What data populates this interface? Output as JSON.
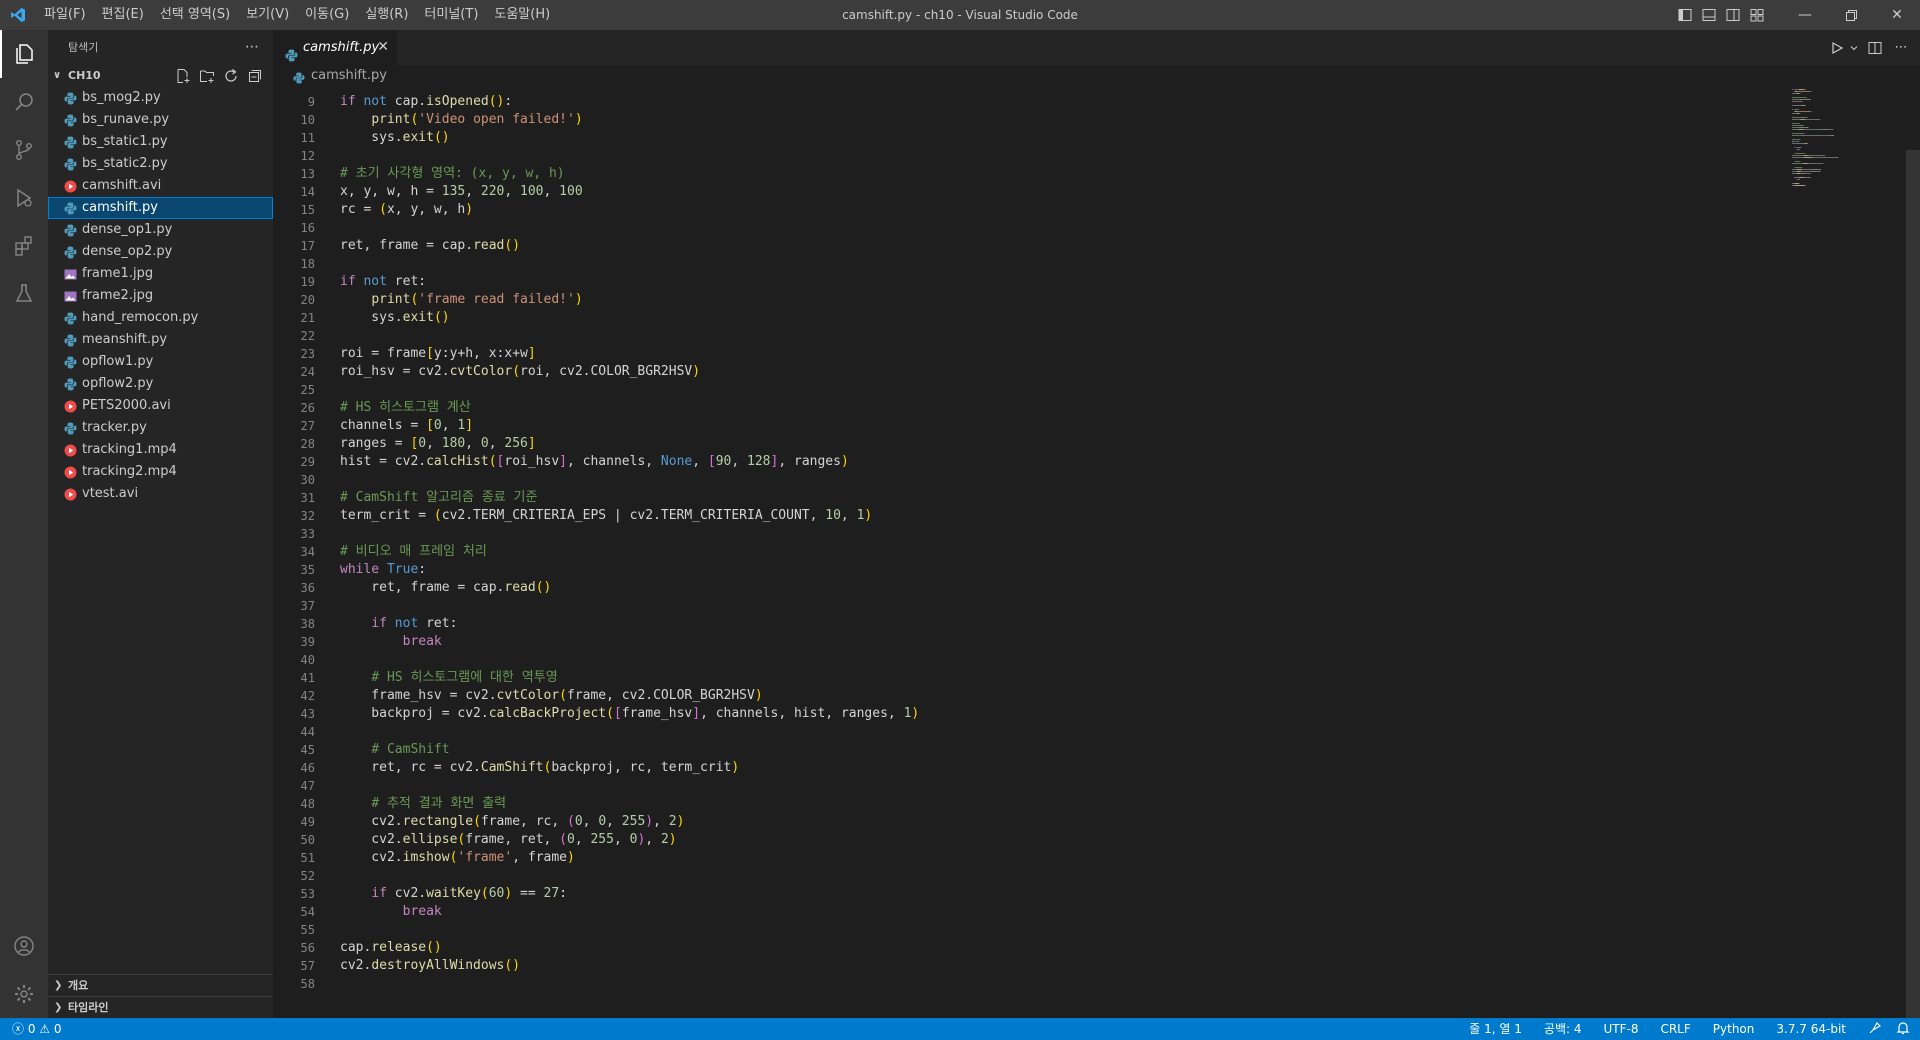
{
  "window": {
    "title": "camshift.py - ch10 - Visual Studio Code",
    "menu": [
      "파일(F)",
      "편집(E)",
      "선택 영역(S)",
      "보기(V)",
      "이동(G)",
      "실행(R)",
      "터미널(T)",
      "도움말(H)"
    ]
  },
  "sidebar": {
    "header": "탐색기",
    "folder": "CH10",
    "files": [
      {
        "name": "bs_mog2.py",
        "type": "python"
      },
      {
        "name": "bs_runave.py",
        "type": "python"
      },
      {
        "name": "bs_static1.py",
        "type": "python"
      },
      {
        "name": "bs_static2.py",
        "type": "python"
      },
      {
        "name": "camshift.avi",
        "type": "video"
      },
      {
        "name": "camshift.py",
        "type": "python"
      },
      {
        "name": "dense_op1.py",
        "type": "python"
      },
      {
        "name": "dense_op2.py",
        "type": "python"
      },
      {
        "name": "frame1.jpg",
        "type": "image"
      },
      {
        "name": "frame2.jpg",
        "type": "image"
      },
      {
        "name": "hand_remocon.py",
        "type": "python"
      },
      {
        "name": "meanshift.py",
        "type": "python"
      },
      {
        "name": "opflow1.py",
        "type": "python"
      },
      {
        "name": "opflow2.py",
        "type": "python"
      },
      {
        "name": "PETS2000.avi",
        "type": "video"
      },
      {
        "name": "tracker.py",
        "type": "python"
      },
      {
        "name": "tracking1.mp4",
        "type": "video"
      },
      {
        "name": "tracking2.mp4",
        "type": "video"
      },
      {
        "name": "vtest.avi",
        "type": "video"
      }
    ],
    "selected_file": "camshift.py",
    "sections": [
      "개요",
      "타임라인"
    ]
  },
  "editor": {
    "tab_label": "camshift.py",
    "breadcrumb": "camshift.py",
    "lines": [
      {
        "n": 9,
        "tokens": [
          {
            "t": "if",
            "c": "kf"
          },
          {
            "t": " "
          },
          {
            "t": "not",
            "c": "kw"
          },
          {
            "t": " cap."
          },
          {
            "t": "isOpened",
            "c": "fn"
          },
          {
            "t": "()",
            "c": "b1"
          },
          {
            "t": ":"
          }
        ]
      },
      {
        "n": 10,
        "tokens": [
          {
            "t": "    "
          },
          {
            "t": "print",
            "c": "fn"
          },
          {
            "t": "(",
            "c": "b1"
          },
          {
            "t": "'Video open failed!'",
            "c": "st"
          },
          {
            "t": ")",
            "c": "b1"
          }
        ]
      },
      {
        "n": 11,
        "tokens": [
          {
            "t": "    sys."
          },
          {
            "t": "exit",
            "c": "fn"
          },
          {
            "t": "()",
            "c": "b1"
          }
        ]
      },
      {
        "n": 12,
        "tokens": []
      },
      {
        "n": 13,
        "tokens": [
          {
            "t": "# 초기 사각형 영역: (x, y, w, h)",
            "c": "cm"
          }
        ]
      },
      {
        "n": 14,
        "tokens": [
          {
            "t": "x, y, w, h = "
          },
          {
            "t": "135",
            "c": "nu"
          },
          {
            "t": ", "
          },
          {
            "t": "220",
            "c": "nu"
          },
          {
            "t": ", "
          },
          {
            "t": "100",
            "c": "nu"
          },
          {
            "t": ", "
          },
          {
            "t": "100",
            "c": "nu"
          }
        ]
      },
      {
        "n": 15,
        "tokens": [
          {
            "t": "rc = "
          },
          {
            "t": "(",
            "c": "b1"
          },
          {
            "t": "x, y, w, h"
          },
          {
            "t": ")",
            "c": "b1"
          }
        ]
      },
      {
        "n": 16,
        "tokens": []
      },
      {
        "n": 17,
        "tokens": [
          {
            "t": "ret, frame = cap."
          },
          {
            "t": "read",
            "c": "fn"
          },
          {
            "t": "()",
            "c": "b1"
          }
        ]
      },
      {
        "n": 18,
        "tokens": []
      },
      {
        "n": 19,
        "tokens": [
          {
            "t": "if",
            "c": "kf"
          },
          {
            "t": " "
          },
          {
            "t": "not",
            "c": "kw"
          },
          {
            "t": " ret:"
          }
        ]
      },
      {
        "n": 20,
        "tokens": [
          {
            "t": "    "
          },
          {
            "t": "print",
            "c": "fn"
          },
          {
            "t": "(",
            "c": "b1"
          },
          {
            "t": "'frame read failed!'",
            "c": "st"
          },
          {
            "t": ")",
            "c": "b1"
          }
        ]
      },
      {
        "n": 21,
        "tokens": [
          {
            "t": "    sys."
          },
          {
            "t": "exit",
            "c": "fn"
          },
          {
            "t": "()",
            "c": "b1"
          }
        ]
      },
      {
        "n": 22,
        "tokens": []
      },
      {
        "n": 23,
        "tokens": [
          {
            "t": "roi = frame"
          },
          {
            "t": "[",
            "c": "b1"
          },
          {
            "t": "y:y+h, x:x+w"
          },
          {
            "t": "]",
            "c": "b1"
          }
        ]
      },
      {
        "n": 24,
        "tokens": [
          {
            "t": "roi_hsv = cv2."
          },
          {
            "t": "cvtColor",
            "c": "fn"
          },
          {
            "t": "(",
            "c": "b1"
          },
          {
            "t": "roi, cv2.COLOR_BGR2HSV"
          },
          {
            "t": ")",
            "c": "b1"
          }
        ]
      },
      {
        "n": 25,
        "tokens": []
      },
      {
        "n": 26,
        "tokens": [
          {
            "t": "# HS 히스토그램 계산",
            "c": "cm"
          }
        ]
      },
      {
        "n": 27,
        "tokens": [
          {
            "t": "channels = "
          },
          {
            "t": "[",
            "c": "b1"
          },
          {
            "t": "0",
            "c": "nu"
          },
          {
            "t": ", "
          },
          {
            "t": "1",
            "c": "nu"
          },
          {
            "t": "]",
            "c": "b1"
          }
        ]
      },
      {
        "n": 28,
        "tokens": [
          {
            "t": "ranges = "
          },
          {
            "t": "[",
            "c": "b1"
          },
          {
            "t": "0",
            "c": "nu"
          },
          {
            "t": ", "
          },
          {
            "t": "180",
            "c": "nu"
          },
          {
            "t": ", "
          },
          {
            "t": "0",
            "c": "nu"
          },
          {
            "t": ", "
          },
          {
            "t": "256",
            "c": "nu"
          },
          {
            "t": "]",
            "c": "b1"
          }
        ]
      },
      {
        "n": 29,
        "tokens": [
          {
            "t": "hist = cv2."
          },
          {
            "t": "calcHist",
            "c": "fn"
          },
          {
            "t": "(",
            "c": "b1"
          },
          {
            "t": "[",
            "c": "b2"
          },
          {
            "t": "roi_hsv"
          },
          {
            "t": "]",
            "c": "b2"
          },
          {
            "t": ", channels, "
          },
          {
            "t": "None",
            "c": "kw"
          },
          {
            "t": ", "
          },
          {
            "t": "[",
            "c": "b2"
          },
          {
            "t": "90",
            "c": "nu"
          },
          {
            "t": ", "
          },
          {
            "t": "128",
            "c": "nu"
          },
          {
            "t": "]",
            "c": "b2"
          },
          {
            "t": ", ranges"
          },
          {
            "t": ")",
            "c": "b1"
          }
        ]
      },
      {
        "n": 30,
        "tokens": []
      },
      {
        "n": 31,
        "tokens": [
          {
            "t": "# CamShift 알고리즘 종료 기준",
            "c": "cm"
          }
        ]
      },
      {
        "n": 32,
        "tokens": [
          {
            "t": "term_crit = "
          },
          {
            "t": "(",
            "c": "b1"
          },
          {
            "t": "cv2.TERM_CRITERIA_EPS | cv2.TERM_CRITERIA_COUNT, "
          },
          {
            "t": "10",
            "c": "nu"
          },
          {
            "t": ", "
          },
          {
            "t": "1",
            "c": "nu"
          },
          {
            "t": ")",
            "c": "b1"
          }
        ]
      },
      {
        "n": 33,
        "tokens": []
      },
      {
        "n": 34,
        "tokens": [
          {
            "t": "# 비디오 매 프레임 처리",
            "c": "cm"
          }
        ]
      },
      {
        "n": 35,
        "tokens": [
          {
            "t": "while",
            "c": "kf"
          },
          {
            "t": " "
          },
          {
            "t": "True",
            "c": "kw"
          },
          {
            "t": ":"
          }
        ]
      },
      {
        "n": 36,
        "tokens": [
          {
            "t": "    ret, frame = cap."
          },
          {
            "t": "read",
            "c": "fn"
          },
          {
            "t": "()",
            "c": "b1"
          }
        ]
      },
      {
        "n": 37,
        "tokens": []
      },
      {
        "n": 38,
        "tokens": [
          {
            "t": "    "
          },
          {
            "t": "if",
            "c": "kf"
          },
          {
            "t": " "
          },
          {
            "t": "not",
            "c": "kw"
          },
          {
            "t": " ret:"
          }
        ]
      },
      {
        "n": 39,
        "tokens": [
          {
            "t": "        "
          },
          {
            "t": "break",
            "c": "kf"
          }
        ]
      },
      {
        "n": 40,
        "tokens": []
      },
      {
        "n": 41,
        "tokens": [
          {
            "t": "    "
          },
          {
            "t": "# HS 히스토그램에 대한 역투영",
            "c": "cm"
          }
        ]
      },
      {
        "n": 42,
        "tokens": [
          {
            "t": "    frame_hsv = cv2."
          },
          {
            "t": "cvtColor",
            "c": "fn"
          },
          {
            "t": "(",
            "c": "b1"
          },
          {
            "t": "frame, cv2.COLOR_BGR2HSV"
          },
          {
            "t": ")",
            "c": "b1"
          }
        ]
      },
      {
        "n": 43,
        "tokens": [
          {
            "t": "    backproj = cv2."
          },
          {
            "t": "calcBackProject",
            "c": "fn"
          },
          {
            "t": "(",
            "c": "b1"
          },
          {
            "t": "[",
            "c": "b2"
          },
          {
            "t": "frame_hsv"
          },
          {
            "t": "]",
            "c": "b2"
          },
          {
            "t": ", channels, hist, ranges, "
          },
          {
            "t": "1",
            "c": "nu"
          },
          {
            "t": ")",
            "c": "b1"
          }
        ]
      },
      {
        "n": 44,
        "tokens": []
      },
      {
        "n": 45,
        "tokens": [
          {
            "t": "    "
          },
          {
            "t": "# CamShift",
            "c": "cm"
          }
        ]
      },
      {
        "n": 46,
        "tokens": [
          {
            "t": "    ret, rc = cv2."
          },
          {
            "t": "CamShift",
            "c": "fn"
          },
          {
            "t": "(",
            "c": "b1"
          },
          {
            "t": "backproj, rc, term_crit"
          },
          {
            "t": ")",
            "c": "b1"
          }
        ]
      },
      {
        "n": 47,
        "tokens": []
      },
      {
        "n": 48,
        "tokens": [
          {
            "t": "    "
          },
          {
            "t": "# 추적 결과 화면 출력",
            "c": "cm"
          }
        ]
      },
      {
        "n": 49,
        "tokens": [
          {
            "t": "    cv2."
          },
          {
            "t": "rectangle",
            "c": "fn"
          },
          {
            "t": "(",
            "c": "b1"
          },
          {
            "t": "frame, rc, "
          },
          {
            "t": "(",
            "c": "b2"
          },
          {
            "t": "0",
            "c": "nu"
          },
          {
            "t": ", "
          },
          {
            "t": "0",
            "c": "nu"
          },
          {
            "t": ", "
          },
          {
            "t": "255",
            "c": "nu"
          },
          {
            "t": ")",
            "c": "b2"
          },
          {
            "t": ", "
          },
          {
            "t": "2",
            "c": "nu"
          },
          {
            "t": ")",
            "c": "b1"
          }
        ]
      },
      {
        "n": 50,
        "tokens": [
          {
            "t": "    cv2."
          },
          {
            "t": "ellipse",
            "c": "fn"
          },
          {
            "t": "(",
            "c": "b1"
          },
          {
            "t": "frame, ret, "
          },
          {
            "t": "(",
            "c": "b2"
          },
          {
            "t": "0",
            "c": "nu"
          },
          {
            "t": ", "
          },
          {
            "t": "255",
            "c": "nu"
          },
          {
            "t": ", "
          },
          {
            "t": "0",
            "c": "nu"
          },
          {
            "t": ")",
            "c": "b2"
          },
          {
            "t": ", "
          },
          {
            "t": "2",
            "c": "nu"
          },
          {
            "t": ")",
            "c": "b1"
          }
        ]
      },
      {
        "n": 51,
        "tokens": [
          {
            "t": "    cv2."
          },
          {
            "t": "imshow",
            "c": "fn"
          },
          {
            "t": "(",
            "c": "b1"
          },
          {
            "t": "'frame'",
            "c": "st"
          },
          {
            "t": ", frame"
          },
          {
            "t": ")",
            "c": "b1"
          }
        ]
      },
      {
        "n": 52,
        "tokens": []
      },
      {
        "n": 53,
        "tokens": [
          {
            "t": "    "
          },
          {
            "t": "if",
            "c": "kf"
          },
          {
            "t": " cv2."
          },
          {
            "t": "waitKey",
            "c": "fn"
          },
          {
            "t": "(",
            "c": "b1"
          },
          {
            "t": "60",
            "c": "nu"
          },
          {
            "t": ")",
            "c": "b1"
          },
          {
            "t": " == "
          },
          {
            "t": "27",
            "c": "nu"
          },
          {
            "t": ":"
          }
        ]
      },
      {
        "n": 54,
        "tokens": [
          {
            "t": "        "
          },
          {
            "t": "break",
            "c": "kf"
          }
        ]
      },
      {
        "n": 55,
        "tokens": []
      },
      {
        "n": 56,
        "tokens": [
          {
            "t": "cap."
          },
          {
            "t": "release",
            "c": "fn"
          },
          {
            "t": "()",
            "c": "b1"
          }
        ]
      },
      {
        "n": 57,
        "tokens": [
          {
            "t": "cv2."
          },
          {
            "t": "destroyAllWindows",
            "c": "fn"
          },
          {
            "t": "()",
            "c": "b1"
          }
        ]
      },
      {
        "n": 58,
        "tokens": []
      }
    ]
  },
  "statusbar": {
    "problems": "ⓧ 0 ⚠ 0",
    "position": "줄 1, 열 1",
    "spaces": "공백: 4",
    "encoding": "UTF-8",
    "eol": "CRLF",
    "language": "Python",
    "interpreter": "3.7.7 64-bit"
  },
  "colors": {
    "accent": "#007acc",
    "selection": "#094771",
    "python_icon": "#519aba",
    "video_icon": "#f14c4c",
    "image_icon": "#a074c4"
  }
}
